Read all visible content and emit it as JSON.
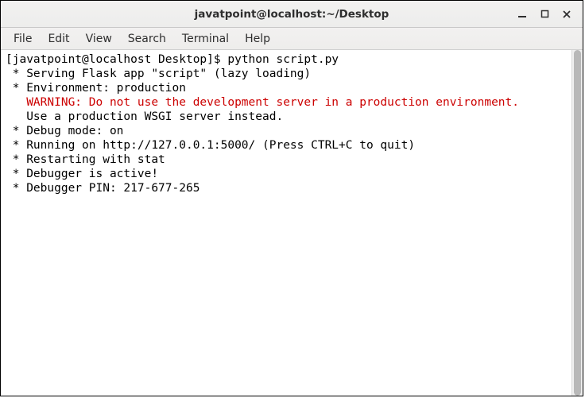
{
  "titlebar": {
    "title": "javatpoint@localhost:~/Desktop"
  },
  "menubar": {
    "items": [
      "File",
      "Edit",
      "View",
      "Search",
      "Terminal",
      "Help"
    ]
  },
  "terminal": {
    "prompt": "[javatpoint@localhost Desktop]$ ",
    "command": "python script.py",
    "line_serving": " * Serving Flask app \"script\" (lazy loading)",
    "line_env": " * Environment: production",
    "line_warning": "   WARNING: Do not use the development server in a production environment.",
    "line_wsgi": "   Use a production WSGI server instead.",
    "line_debug": " * Debug mode: on",
    "line_running": " * Running on http://127.0.0.1:5000/ (Press CTRL+C to quit)",
    "line_restart": " * Restarting with stat",
    "line_debugger": " * Debugger is active!",
    "line_pin": " * Debugger PIN: 217-677-265"
  }
}
